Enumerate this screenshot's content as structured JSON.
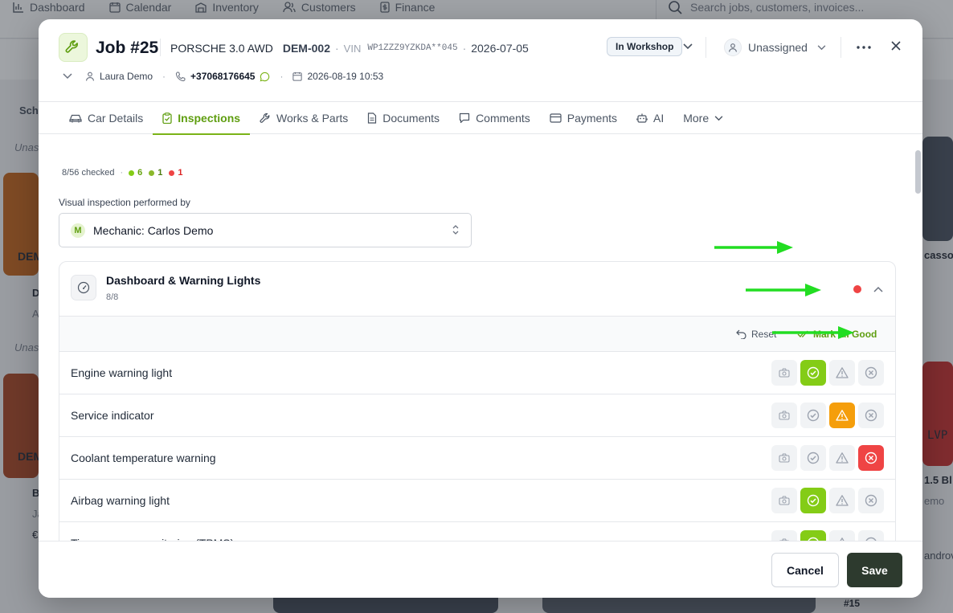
{
  "topnav": {
    "items": [
      "Dashboard",
      "Calendar",
      "Inventory",
      "Customers",
      "Finance"
    ],
    "search_placeholder": "Search jobs, customers, invoices..."
  },
  "background_fragments": {
    "left": [
      "Sche",
      "Unas",
      "DEM",
      "D",
      "A",
      "Unas",
      "DEM",
      "B",
      "Ja",
      "€"
    ],
    "right": [
      "casso",
      "1.5 Bl",
      "emo",
      "LVP",
      "androv"
    ],
    "bottom": [
      "#15"
    ]
  },
  "job": {
    "title": "Job #25",
    "car": "PORSCHE 3.0 AWD",
    "plate": "DEM-002",
    "vin_label": "VIN",
    "vin": "WP1ZZZ9YZKDA**045",
    "date": "2026-07-05",
    "status": "In Workshop",
    "assignee": "Unassigned",
    "customer": "Laura Demo",
    "phone": "+37068176645",
    "appointment": "2026-08-19 10:53"
  },
  "tabs": [
    {
      "label": "Car Details",
      "icon": "car-icon",
      "active": false
    },
    {
      "label": "Inspections",
      "icon": "clipboard-icon",
      "active": true
    },
    {
      "label": "Works & Parts",
      "icon": "wrench-icon",
      "active": false
    },
    {
      "label": "Documents",
      "icon": "document-icon",
      "active": false
    },
    {
      "label": "Comments",
      "icon": "comment-icon",
      "active": false
    },
    {
      "label": "Payments",
      "icon": "card-icon",
      "active": false
    },
    {
      "label": "AI",
      "icon": "robot-icon",
      "active": false
    },
    {
      "label": "More",
      "icon": "chevron-down-icon",
      "active": false
    }
  ],
  "summary": {
    "checked": "8/56 checked",
    "good": "6",
    "warn": "1",
    "bad": "1",
    "colors": {
      "good": "#84cc16",
      "warn": "#8bb82b",
      "bad": "#ef4444"
    }
  },
  "inspector": {
    "label": "Visual inspection performed by",
    "initial": "M",
    "value": "Mechanic: Carlos Demo"
  },
  "section": {
    "title": "Dashboard & Warning Lights",
    "progress": "8/8",
    "reset_label": "Reset",
    "mark_all_label": "Mark all Good",
    "items": [
      {
        "label": "Engine warning light",
        "state": "good"
      },
      {
        "label": "Service indicator",
        "state": "warn"
      },
      {
        "label": "Coolant temperature warning",
        "state": "bad"
      },
      {
        "label": "Airbag warning light",
        "state": "good"
      },
      {
        "label": "Tire pressure monitoring (TPMS)",
        "state": "good"
      }
    ]
  },
  "footer": {
    "cancel_label": "Cancel",
    "save_label": "Save"
  },
  "colors": {
    "accent": "#7ab317",
    "good": "#84cc16",
    "warn": "#f59e0b",
    "bad": "#ef4444",
    "annotation_arrow": "#22dd22",
    "save_bg": "#2d3a2e"
  }
}
